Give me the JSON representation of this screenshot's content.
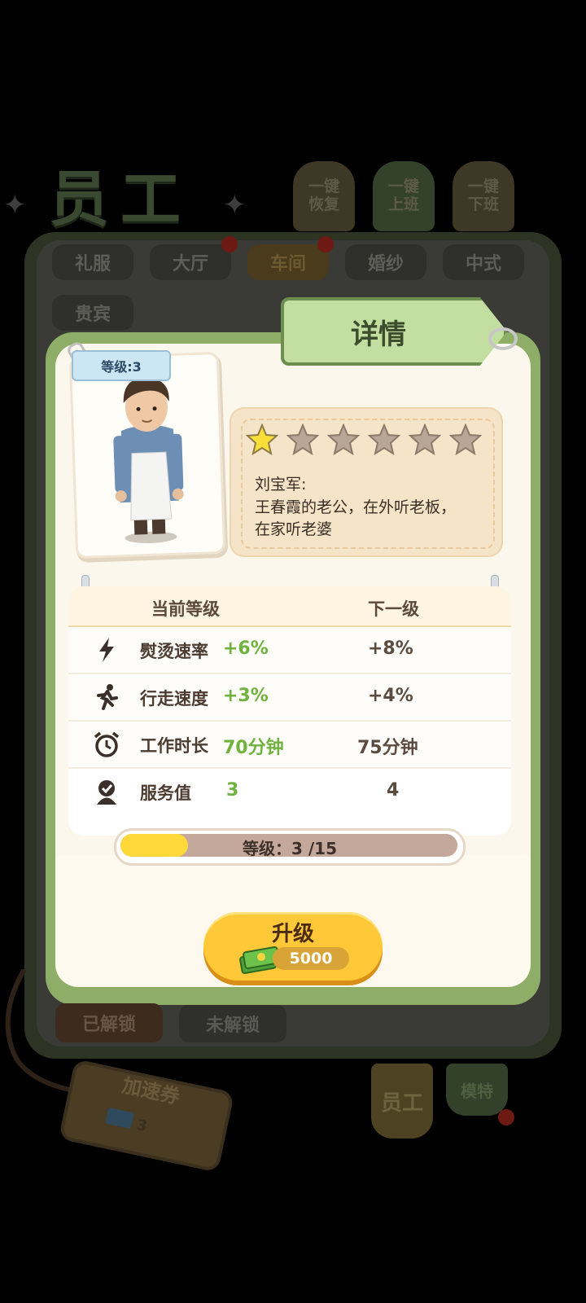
{
  "header": {
    "title": "员工",
    "buttons": [
      {
        "label": "一键\n恢复",
        "style": "tan"
      },
      {
        "label": "一键\n上班",
        "style": "green"
      },
      {
        "label": "一键\n下班",
        "style": "tan"
      }
    ]
  },
  "tabs": [
    {
      "label": "礼服",
      "active": false
    },
    {
      "label": "大厅",
      "active": false,
      "dot": true
    },
    {
      "label": "车间",
      "active": true,
      "dot": true
    },
    {
      "label": "婚纱",
      "active": false
    },
    {
      "label": "中式",
      "active": false
    },
    {
      "label": "贵宾",
      "active": false
    }
  ],
  "detail": {
    "tag": "详情",
    "level_badge": "等级:3",
    "stars_total": 6,
    "stars_filled": 1,
    "name_line": "刘宝军:",
    "description": "王春霞的老公，在外听老板，\n在家听老婆",
    "table": {
      "col_current": "当前等级",
      "col_next": "下一级",
      "rows": [
        {
          "icon": "lightning-icon",
          "name": "熨烫速率",
          "current": "+6%",
          "next": "+8%"
        },
        {
          "icon": "running-icon",
          "name": "行走速度",
          "current": "+3%",
          "next": "+4%"
        },
        {
          "icon": "alarm-clock-icon",
          "name": "工作时长",
          "current": "70分钟",
          "next": "75分钟"
        },
        {
          "icon": "service-icon",
          "name": "服务值",
          "current": "3",
          "next": "4"
        }
      ]
    },
    "level_progress": {
      "text": "等级：3 /15",
      "current": 3,
      "max": 15
    },
    "upgrade": {
      "label": "升级",
      "cost": "5000"
    }
  },
  "bottom": {
    "unlocked": "已解锁",
    "locked": "未解锁",
    "coupon_label": "加速券",
    "coupon_count": "3",
    "tab_staff": "员工",
    "tab_model": "模特"
  },
  "colors": {
    "accent_green": "#6fb23d",
    "modal_frame": "#8eae68",
    "upgrade_button": "#ffc838"
  }
}
